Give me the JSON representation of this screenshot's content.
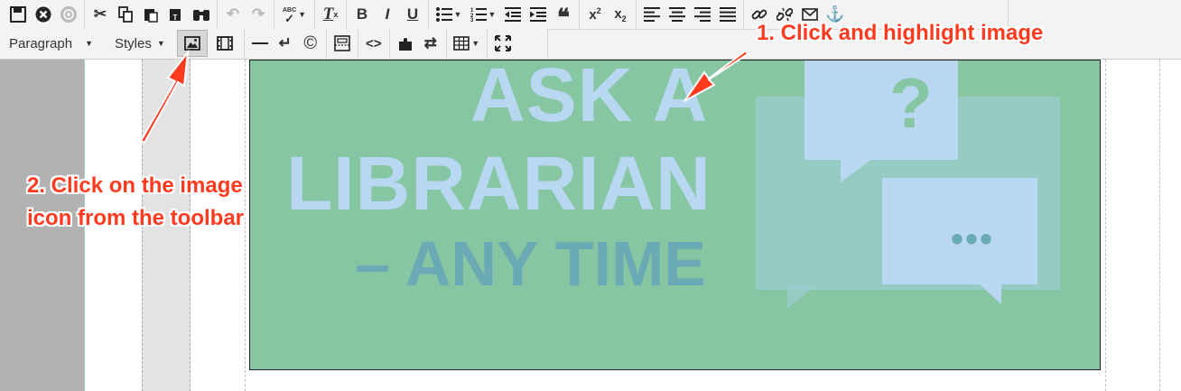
{
  "toolbar": {
    "row1": [
      {
        "name": "save-icon",
        "glyph": "💾︎"
      },
      {
        "name": "cancel-icon",
        "glyph": "⊗"
      },
      {
        "name": "help-icon",
        "glyph": "◎"
      },
      {
        "name": "cut-icon",
        "glyph": "✂"
      },
      {
        "name": "copy-icon",
        "glyph": "⧉"
      },
      {
        "name": "paste-icon",
        "glyph": "📋︎"
      },
      {
        "name": "paste-text-icon",
        "glyph": "📋︎"
      },
      {
        "name": "find-icon",
        "glyph": "⛯"
      },
      {
        "name": "undo-icon",
        "glyph": "↶"
      },
      {
        "name": "redo-icon",
        "glyph": "↷"
      },
      {
        "name": "spellcheck-icon",
        "glyph": "✓"
      },
      {
        "name": "clear-format-icon",
        "glyph": "T"
      },
      {
        "name": "bold-icon",
        "glyph": "B"
      },
      {
        "name": "italic-icon",
        "glyph": "I"
      },
      {
        "name": "underline-icon",
        "glyph": "U"
      },
      {
        "name": "bullet-list-icon",
        "glyph": "☰"
      },
      {
        "name": "numbered-list-icon",
        "glyph": "☰"
      },
      {
        "name": "outdent-icon",
        "glyph": "⇤"
      },
      {
        "name": "indent-icon",
        "glyph": "⇥"
      },
      {
        "name": "blockquote-icon",
        "glyph": "❝"
      },
      {
        "name": "superscript-icon",
        "glyph": "x"
      },
      {
        "name": "subscript-icon",
        "glyph": "x"
      },
      {
        "name": "align-left-icon",
        "glyph": "≡"
      },
      {
        "name": "align-center-icon",
        "glyph": "≡"
      },
      {
        "name": "align-right-icon",
        "glyph": "≡"
      },
      {
        "name": "align-justify-icon",
        "glyph": "≡"
      },
      {
        "name": "link-icon",
        "glyph": "🔗︎"
      },
      {
        "name": "unlink-icon",
        "glyph": "⛓"
      },
      {
        "name": "email-icon",
        "glyph": "✉"
      },
      {
        "name": "anchor-icon",
        "glyph": "⚓"
      }
    ],
    "paragraph_label": "Paragraph",
    "styles_label": "Styles",
    "spellcheck_small": "ABC"
  },
  "banner": {
    "line1": "ASK A",
    "line2": "LIBRARIAN",
    "line3": "– ANY TIME",
    "question_mark": "?",
    "dots": "•••"
  },
  "annotations": {
    "step1": "1. Click and highlight image",
    "step2_line1": "2. Click on the image",
    "step2_line2": "icon from the toolbar"
  },
  "colors": {
    "banner_bg": "#86c6a2",
    "bubble": "#b8d8f2",
    "arrow": "#ff3a1f"
  }
}
